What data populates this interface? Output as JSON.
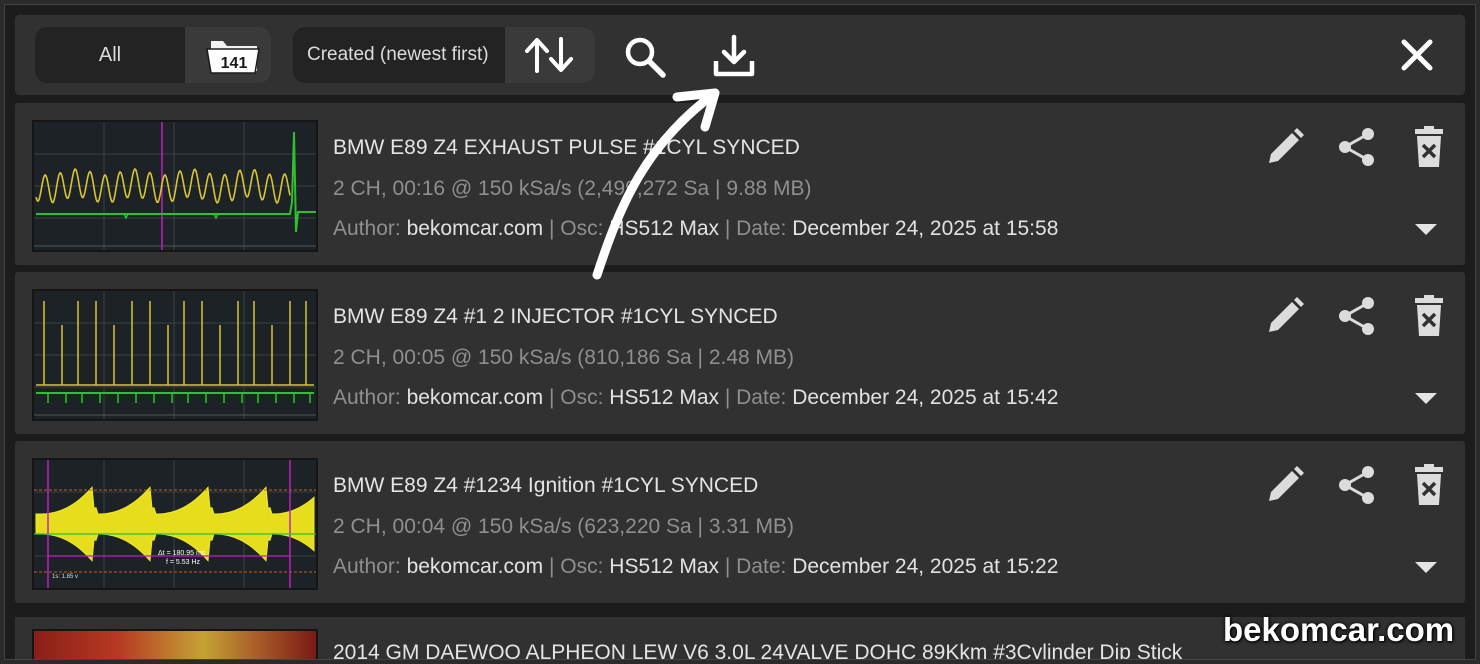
{
  "toolbar": {
    "filter_label": "All",
    "file_count": "141",
    "sort_label": "Created (newest first)",
    "icons": [
      "folder-count-icon",
      "sort-icon",
      "search-icon",
      "download-icon",
      "close-icon"
    ]
  },
  "records": [
    {
      "title": "BMW E89 Z4 EXHAUST PULSE #1CYL SYNCED",
      "meta": "2 CH, 00:16 @ 150 kSa/s (2,499,272 Sa | 9.88 MB)",
      "author_label": "Author:",
      "author": "bekomcar.com",
      "osc_label": "Osc:",
      "osc": "HS512 Max",
      "date_label": "Date:",
      "date": "December 24, 2025 at 15:58",
      "thumb_style": "exhaust"
    },
    {
      "title": "BMW E89 Z4 #1 2 INJECTOR #1CYL SYNCED",
      "meta": "2 CH, 00:05 @ 150 kSa/s (810,186 Sa | 2.48 MB)",
      "author_label": "Author:",
      "author": "bekomcar.com",
      "osc_label": "Osc:",
      "osc": "HS512 Max",
      "date_label": "Date:",
      "date": "December 24, 2025 at 15:42",
      "thumb_style": "injector"
    },
    {
      "title": "BMW E89 Z4 #1234 Ignition #1CYL SYNCED",
      "meta": "2 CH, 00:04 @ 150 kSa/s (623,220 Sa | 3.31 MB)",
      "author_label": "Author:",
      "author": "bekomcar.com",
      "osc_label": "Osc:",
      "osc": "HS512 Max",
      "date_label": "Date:",
      "date": "December 24, 2025 at 15:22",
      "thumb_style": "ignition",
      "thumb_text": [
        "Δt = 180.95 ms",
        "f = 5.53 Hz",
        "1s: 1.85 v"
      ]
    }
  ],
  "partial_record": {
    "title": "2014 GM DAEWOO ALPHEON LEW V6 3.0L 24VALVE DOHC 89Kkm #3Cylinder Dip Stick"
  },
  "watermark": "bekomcar.com",
  "colors": {
    "trace_yellow": "#d8c531",
    "trace_green": "#2fbf2f",
    "cursor_magenta": "#c020c0",
    "background": "#1c1c1c",
    "panel": "#313131"
  }
}
